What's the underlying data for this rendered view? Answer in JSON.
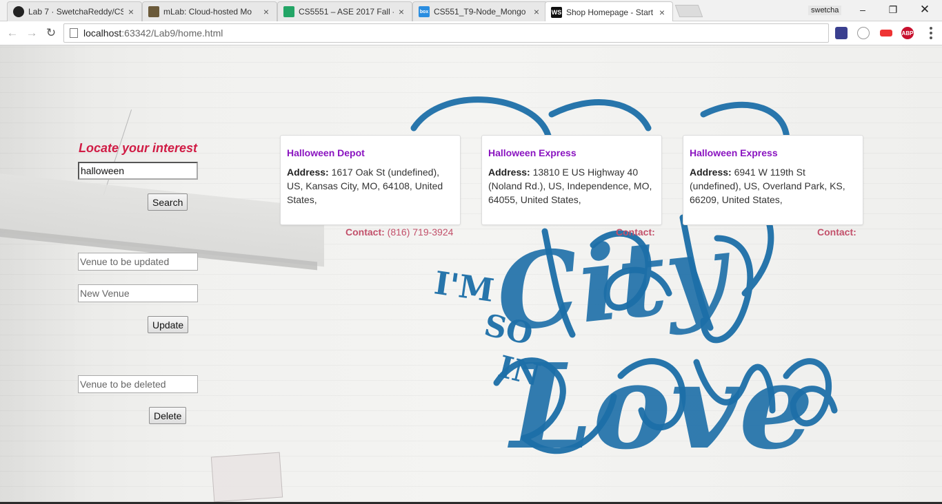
{
  "browser": {
    "tabs": [
      {
        "title": "Lab 7 · SwetchaReddy/CS",
        "icon": "github-icon",
        "active": false
      },
      {
        "title": "mLab: Cloud-hosted Mo",
        "icon": "mlab-icon",
        "active": false
      },
      {
        "title": "CS5551 – ASE 2017 Fall -",
        "icon": "sheets-icon",
        "active": false
      },
      {
        "title": "CS551_T9-Node_Mongo",
        "icon": "box-icon",
        "active": false
      },
      {
        "title": "Shop Homepage - Start I",
        "icon": "webstorm-icon",
        "active": true
      }
    ],
    "profile_name": "swetcha",
    "url_host": "localhost",
    "url_path": ":63342/Lab9/home.html",
    "extensions": [
      "extension-icon-1",
      "extension-icon-2",
      "extension-icon-3",
      "adblock-plus-icon"
    ],
    "extension_labels": {
      "adblock": "ABP",
      "webstorm": "WS",
      "box": "box"
    }
  },
  "form": {
    "heading": "Locate your interest",
    "search_value": "halloween",
    "search_button": "Search",
    "update_placeholder": "Venue to be updated",
    "new_venue_placeholder": "New Venue",
    "update_button": "Update",
    "delete_placeholder": "Venue to be deleted",
    "delete_button": "Delete"
  },
  "results": [
    {
      "name": "Halloween Depot",
      "address_label": "Address:",
      "address": "1617 Oak St (undefined), US, Kansas City, MO, 64108, United States,",
      "contact_label": "Contact:",
      "contact": "(816) 719-3924"
    },
    {
      "name": "Halloween Express",
      "address_label": "Address:",
      "address": "13810 E US Highway 40 (Noland Rd.), US, Independence, MO, 64055, United States,",
      "contact_label": "Contact:",
      "contact": ""
    },
    {
      "name": "Halloween Express",
      "address_label": "Address:",
      "address": "6941 W 119th St (undefined), US, Overland Park, KS, 66209, United States,",
      "contact_label": "Contact:",
      "contact": ""
    }
  ],
  "background": {
    "mural_text": [
      "I'M",
      "SO",
      "IN",
      "City",
      "Love"
    ],
    "mural_color": "#1d6fa8"
  },
  "colors": {
    "heading": "#d01c45",
    "card_title": "#8a14c0",
    "contact": "#c2506a"
  }
}
